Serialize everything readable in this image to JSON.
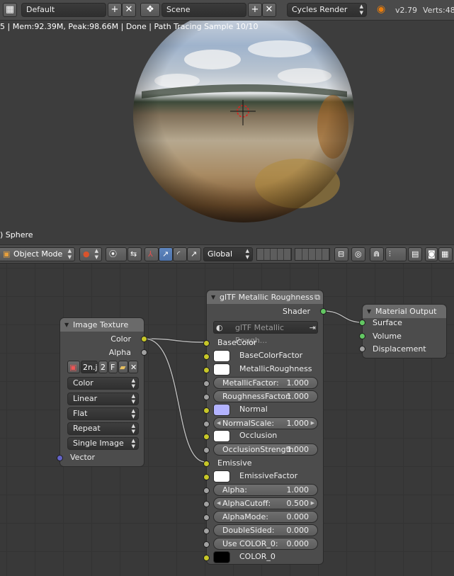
{
  "top_header": {
    "screen_layout": "Default",
    "scene": "Scene",
    "render_engine": "Cycles Render",
    "version": "v2.79",
    "stats": "Verts:48",
    "colors": {
      "header": "#4a4a4a",
      "dropdown": "#353535"
    }
  },
  "viewport": {
    "status_text": "5 | Mem:92.39M, Peak:98.66M | Done | Path Tracing Sample 10/10",
    "object_name": ") Sphere",
    "background": "#3d3d3d"
  },
  "view3d_header": {
    "mode": "Object Mode",
    "orientation": "Global"
  },
  "image_texture_node": {
    "title": "Image Texture",
    "outputs": [
      "Color",
      "Alpha"
    ],
    "image_name": "2n.j",
    "users": "2",
    "fake_user": "F",
    "color_space": "Color",
    "interpolation": "Linear",
    "projection": "Flat",
    "extension": "Repeat",
    "source": "Single Image",
    "input": "Vector"
  },
  "gltf_node": {
    "title": "glTF Metallic Roughness",
    "output": "Shader",
    "group_name": "glTF Metallic Rough...",
    "inputs": {
      "base_color": "BaseColor",
      "base_color_factor": "BaseColorFactor",
      "metallic_roughness": "MetallicRoughness",
      "metallic_factor_label": "MetallicFactor:",
      "metallic_factor": "1.000",
      "roughness_factor_label": "RoughnessFactor:",
      "roughness_factor": "1.000",
      "normal": "Normal",
      "normal_scale_label": "NormalScale:",
      "normal_scale": "1.000",
      "occlusion": "Occlusion",
      "occlusion_strength_label": "OcclusionStrength:",
      "occlusion_strength": "1.000",
      "emissive": "Emissive",
      "emissive_factor": "EmissiveFactor",
      "alpha_label": "Alpha:",
      "alpha": "1.000",
      "alpha_cutoff_label": "AlphaCutoff:",
      "alpha_cutoff": "0.500",
      "alpha_mode_label": "AlphaMode:",
      "alpha_mode": "0.000",
      "double_sided_label": "DoubleSided:",
      "double_sided": "0.000",
      "use_color0_label": "Use COLOR_0:",
      "use_color0": "0.000",
      "color0": "COLOR_0"
    },
    "swatch_colors": {
      "white": "#ffffff",
      "normal": "#b3b3ff",
      "black": "#000000"
    }
  },
  "material_output_node": {
    "title": "Material Output",
    "inputs": [
      "Surface",
      "Volume",
      "Displacement"
    ]
  },
  "socket_colors": {
    "color": "#c7c729",
    "float": "#a1a1a1",
    "shader": "#63c763",
    "vector": "#6363c7"
  }
}
